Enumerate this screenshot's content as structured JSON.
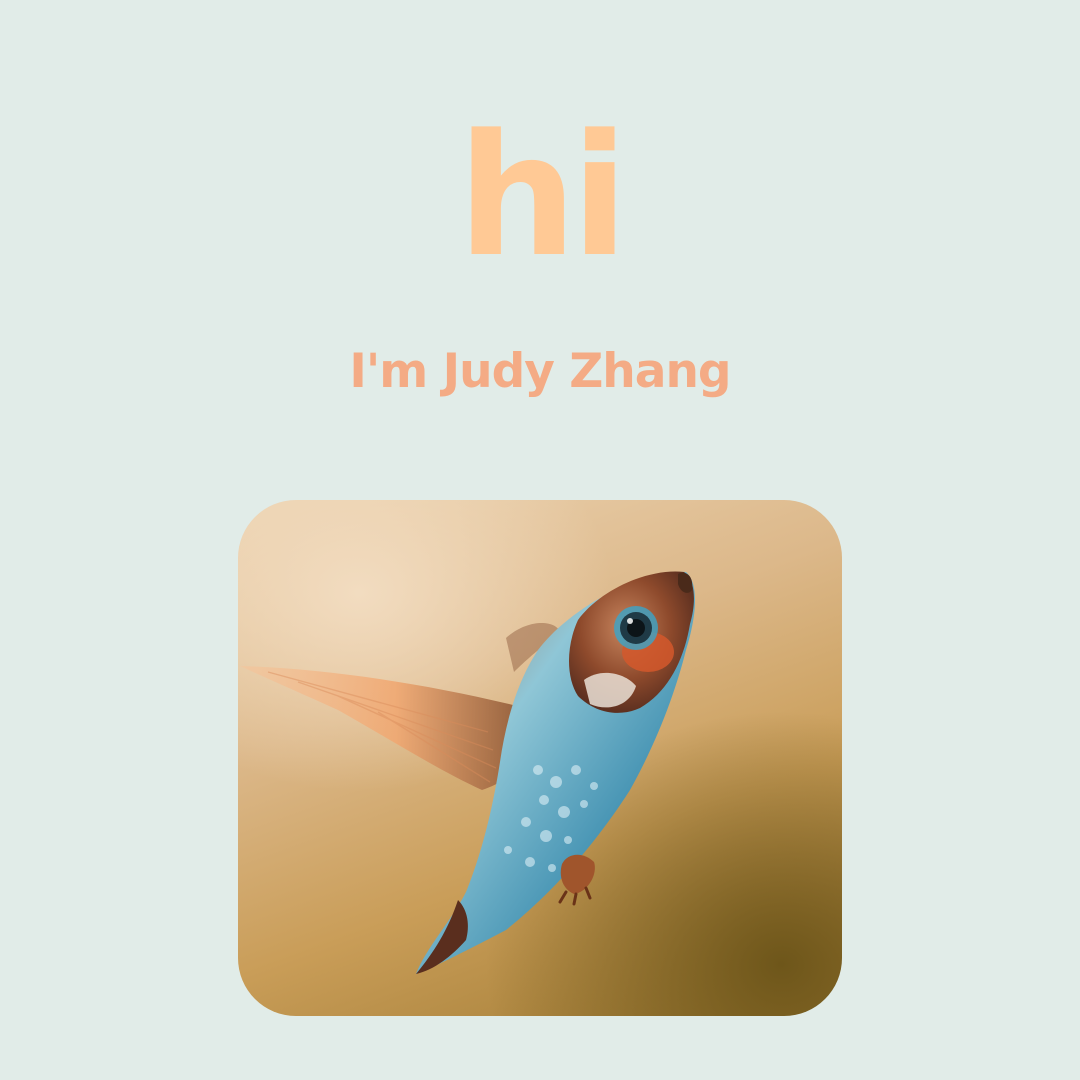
{
  "hero": {
    "greeting": "hi",
    "name_line": "I'm Judy Zhang"
  },
  "photo": {
    "subject": "hummingbird-in-flight"
  },
  "colors": {
    "background": "#e1ece8",
    "greeting": "#ffc995",
    "name": "#f4ab85"
  }
}
